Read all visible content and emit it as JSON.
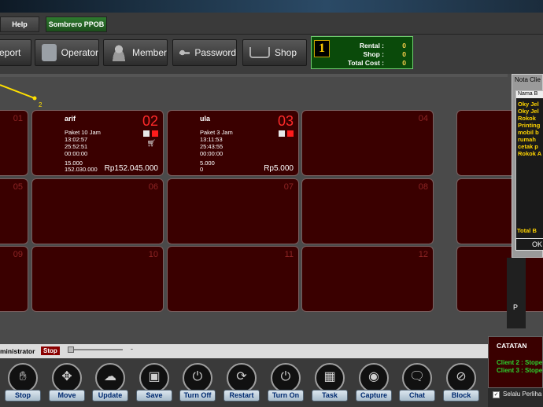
{
  "menu": {
    "help": "Help",
    "ppob": "Sombrero PPOB"
  },
  "toolbar": {
    "report": "eport",
    "operator": "Operator",
    "member": "Member",
    "password": "Password",
    "shop": "Shop"
  },
  "counter": {
    "number": "1",
    "rental_label": "Rental :",
    "rental": "0",
    "shop_label": "Shop :",
    "shop": "0",
    "total_label": "Total Cost :",
    "total": "0"
  },
  "pointer_label": "2",
  "tiles": {
    "t01": {
      "num": "01"
    },
    "t02": {
      "num": "02",
      "name": "arif",
      "package": "Paket 10 Jam",
      "start": "13:02:57",
      "elapsed": "25:52:51",
      "remain": "00:00:00",
      "amount1": "15.000",
      "amount2": "152.030.000",
      "price": "Rp152.045.000"
    },
    "t03": {
      "num": "03",
      "name": "ula",
      "package": "Paket 3 Jam",
      "start": "13:11:53",
      "elapsed": "25:43:55",
      "remain": "00:00:00",
      "amount1": "5.000",
      "amount2": "0",
      "price": "Rp5.000"
    },
    "t04": {
      "num": "04"
    },
    "t05": {
      "num": "05"
    },
    "t06": {
      "num": "06"
    },
    "t07": {
      "num": "07"
    },
    "t08": {
      "num": "08"
    },
    "t09": {
      "num": "09"
    },
    "t10": {
      "num": "10"
    },
    "t11": {
      "num": "11"
    },
    "t12": {
      "num": "12"
    }
  },
  "nota": {
    "title": "Nota Clie",
    "header": "Nama B",
    "items": [
      "Oky Jel",
      "Oky Jel",
      "Rokok",
      "Printing",
      "mobil b",
      "rumah",
      "cetak p",
      "Rokok A"
    ],
    "total": "Total B",
    "ok": "OK"
  },
  "side_label": "P",
  "status": {
    "admin": "ministrator",
    "stop": "Stop",
    "minus": "-"
  },
  "actions": [
    {
      "label": "Stop",
      "icon": "hand-stop-icon"
    },
    {
      "label": "Move",
      "icon": "move-arrows-icon"
    },
    {
      "label": "Update",
      "icon": "cloud-update-icon"
    },
    {
      "label": "Save",
      "icon": "save-icon"
    },
    {
      "label": "Turn Off",
      "icon": "power-icon"
    },
    {
      "label": "Restart",
      "icon": "restart-icon"
    },
    {
      "label": "Turn On",
      "icon": "power-on-icon"
    },
    {
      "label": "Task",
      "icon": "task-icon"
    },
    {
      "label": "Capture",
      "icon": "camera-icon"
    },
    {
      "label": "Chat",
      "icon": "chat-bubble-icon"
    },
    {
      "label": "Block",
      "icon": "block-icon"
    }
  ],
  "catatan": {
    "title": "CATATAN",
    "line1": "Client 2 : Stope",
    "line2": "Client 3 : Stope"
  },
  "selalu": "Selalu Perliha",
  "colors": {
    "tile_bg": "#3a0000",
    "active_num": "#ff2a2a",
    "counter_bg": "#0a4a0a",
    "label_blue": "#002a70"
  }
}
